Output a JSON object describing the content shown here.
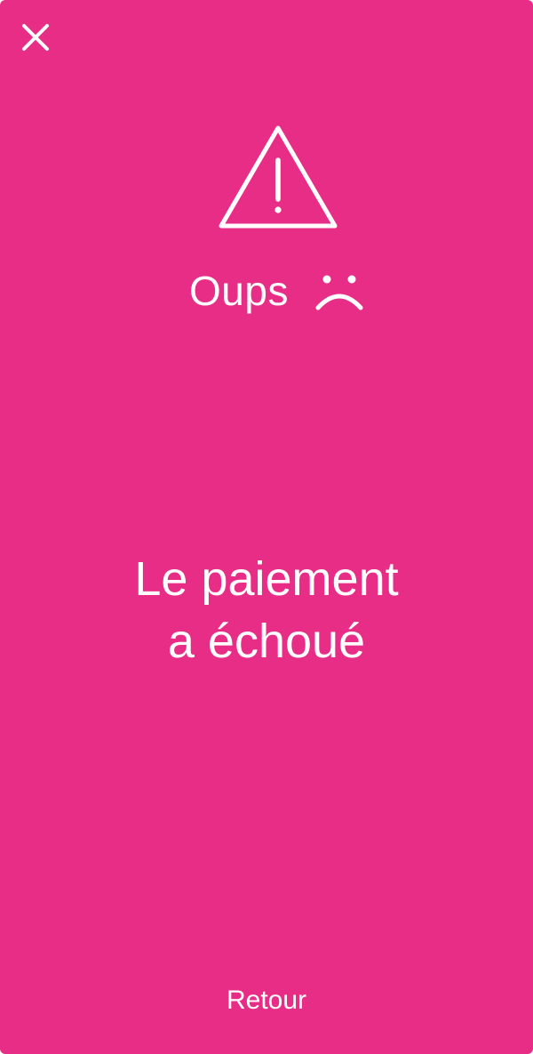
{
  "header": {
    "close_icon": "close-icon"
  },
  "alert": {
    "icon": "warning-icon",
    "title": "Oups",
    "face_icon": "sad-face-icon",
    "message_line1": "Le paiement",
    "message_line2": "a échoué"
  },
  "footer": {
    "back_label": "Retour"
  },
  "colors": {
    "background": "#e82d87",
    "foreground": "#ffffff"
  }
}
